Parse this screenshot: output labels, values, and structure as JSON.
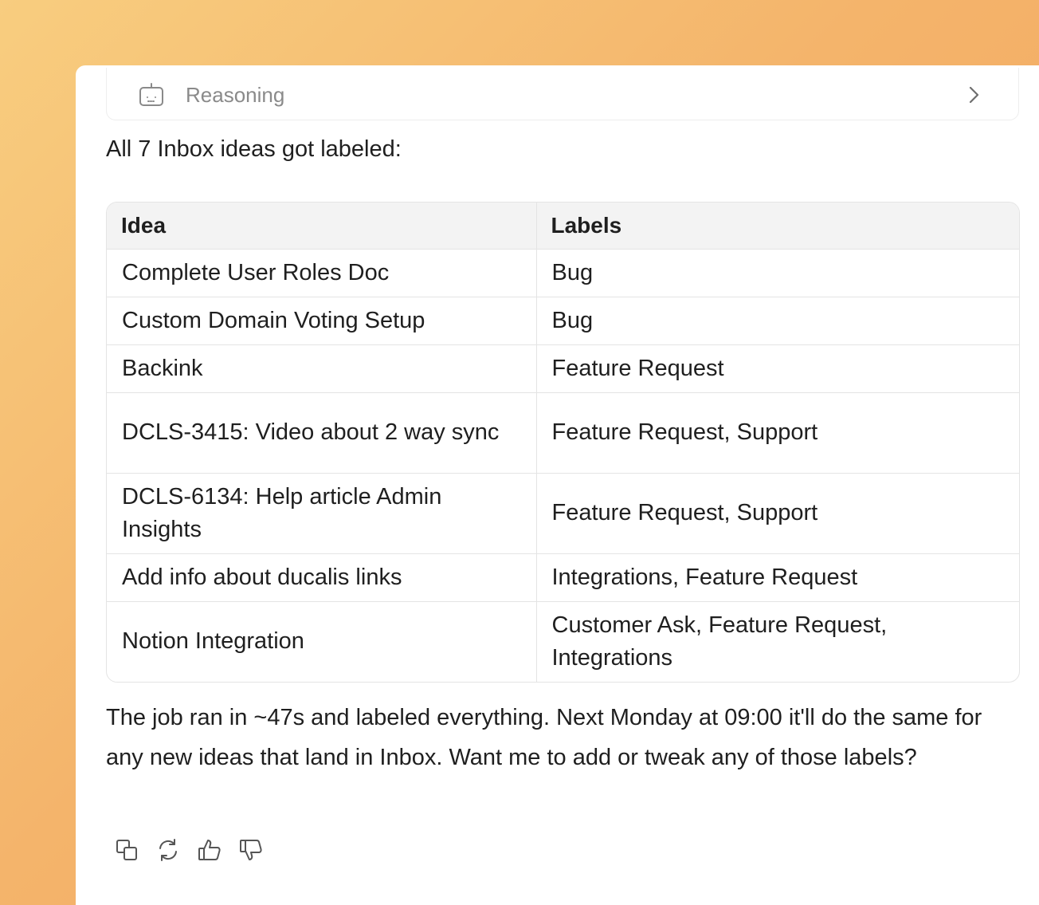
{
  "reasoning": {
    "label": "Reasoning"
  },
  "message": {
    "intro": "All 7 Inbox ideas got labeled:",
    "outro": "The job ran in ~47s and labeled everything. Next Monday at 09:00 it'll do the same for any new ideas that land in Inbox. Want me to add or tweak any of those labels?"
  },
  "table": {
    "headers": [
      "Idea",
      "Labels"
    ],
    "rows": [
      {
        "idea": "Complete User Roles Doc",
        "labels": "Bug"
      },
      {
        "idea": "Custom Domain Voting Setup",
        "labels": "Bug"
      },
      {
        "idea": "Backink",
        "labels": "Feature Request"
      },
      {
        "idea": "DCLS-3415: Video about 2 way sync",
        "labels": "Feature Request, Support"
      },
      {
        "idea": "DCLS-6134: Help article Admin Insights",
        "labels": "Feature Request, Support"
      },
      {
        "idea": "Add info about ducalis links",
        "labels": "Integrations, Feature Request"
      },
      {
        "idea": "Notion Integration",
        "labels": "Customer Ask, Feature Request, Integrations"
      }
    ]
  },
  "actions": [
    {
      "icon": "copy-icon"
    },
    {
      "icon": "regenerate-icon"
    },
    {
      "icon": "thumbs-up-icon"
    },
    {
      "icon": "thumbs-down-icon"
    }
  ],
  "colors": {
    "background_gradient_start": "#f8cd7f",
    "background_gradient_end": "#f1a35d",
    "panel": "#ffffff",
    "muted_text": "#8a8a8a",
    "table_header_bg": "#f3f3f3",
    "border": "#e4e4e4"
  }
}
